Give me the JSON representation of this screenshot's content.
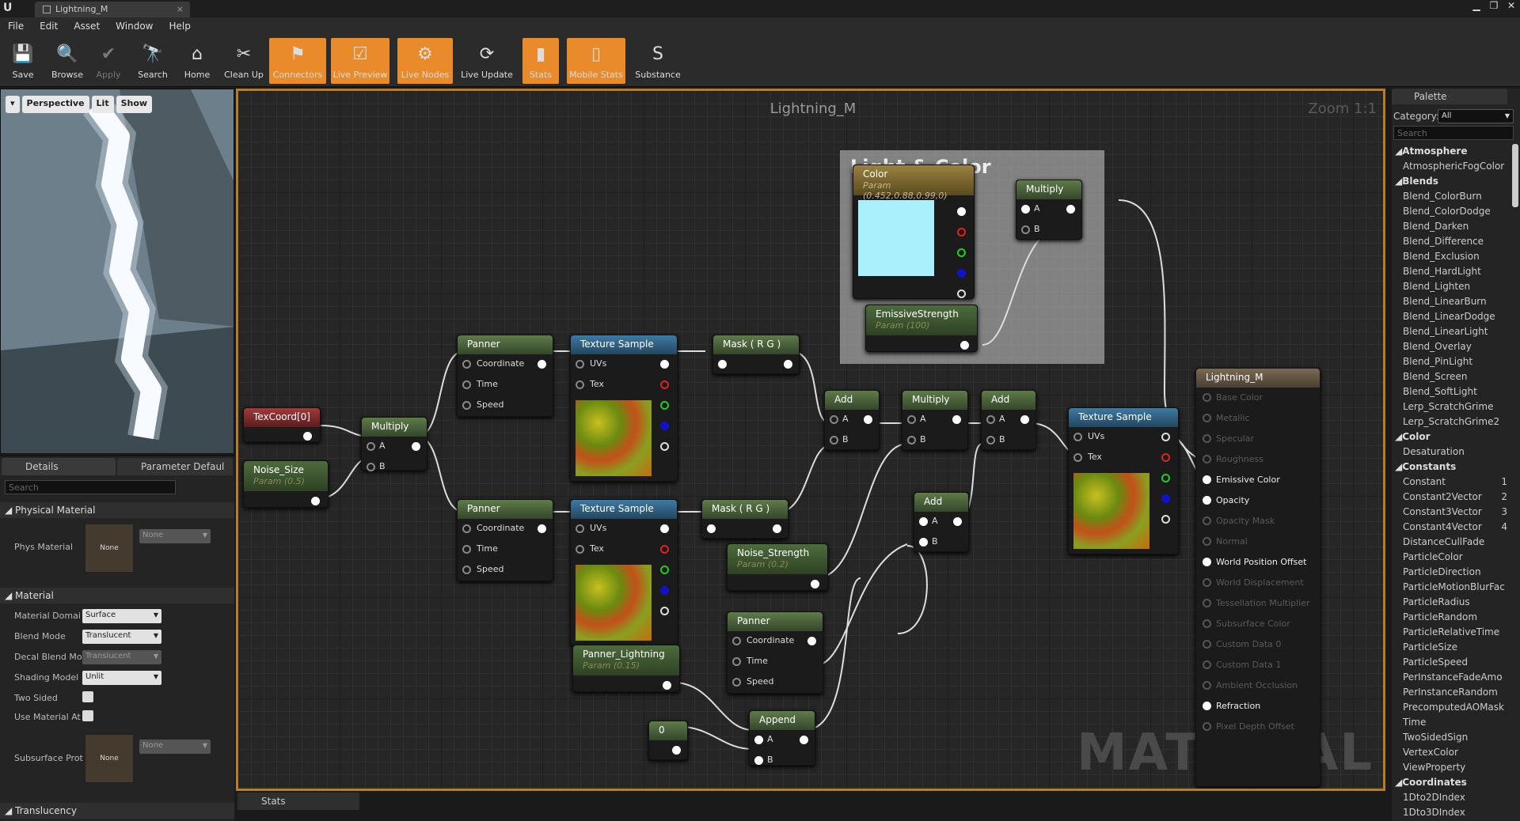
{
  "window": {
    "tab": "Lightning_M",
    "minimize": "▁",
    "restore": "❐",
    "close": "✕"
  },
  "menu": [
    "File",
    "Edit",
    "Asset",
    "Window",
    "Help"
  ],
  "toolbar": [
    {
      "label": "Save",
      "icon": "save-icon",
      "state": "normal"
    },
    {
      "label": "Browse",
      "icon": "browse-icon",
      "state": "normal"
    },
    {
      "label": "Apply",
      "icon": "apply-icon",
      "state": "disabled"
    },
    {
      "label": "Search",
      "icon": "search-icon",
      "state": "normal"
    },
    {
      "label": "Home",
      "icon": "home-icon",
      "state": "normal"
    },
    {
      "label": "Clean Up",
      "icon": "clean-up-icon",
      "state": "normal"
    },
    {
      "label": "Connectors",
      "icon": "connectors-icon",
      "state": "on"
    },
    {
      "label": "Live Preview",
      "icon": "live-preview-icon",
      "state": "on"
    },
    {
      "label": "Live Nodes",
      "icon": "live-nodes-icon",
      "state": "on"
    },
    {
      "label": "Live Update",
      "icon": "live-update-icon",
      "state": "normal"
    },
    {
      "label": "Stats",
      "icon": "stats-icon",
      "state": "on"
    },
    {
      "label": "Mobile Stats",
      "icon": "mobile-stats-icon",
      "state": "on"
    },
    {
      "label": "Substance",
      "icon": "substance-icon",
      "state": "normal"
    }
  ],
  "viewport": {
    "perspective": "Perspective",
    "lit": "Lit",
    "show": "Show"
  },
  "details": {
    "tab1": "Details",
    "tab2": "Parameter Defaul",
    "search_placeholder": "Search",
    "cat_physical": "Physical Material",
    "phys_label": "Phys Material",
    "phys_value": "None",
    "phys_thumb": "None",
    "cat_material": "Material",
    "domain_label": "Material Domai",
    "domain_value": "Surface",
    "blend_label": "Blend Mode",
    "blend_value": "Translucent",
    "decal_label": "Decal Blend Mo",
    "decal_value": "Translucent",
    "shading_label": "Shading Model",
    "shading_value": "Unlit",
    "twosided_label": "Two Sided",
    "usemat_label": "Use Material At",
    "subsurface_label": "Subsurface Prot",
    "subsurface_value": "None",
    "subsurface_thumb": "None",
    "cat_translucency": "Translucency"
  },
  "graph": {
    "title": "Lightning_M",
    "zoom": "Zoom 1:1",
    "watermark": "MATERIAL",
    "comment": "Light & Color"
  },
  "nodes": {
    "texcoord": "TexCoord[0]",
    "noise_size": "Noise_Size",
    "noise_size_param": "Param (0.5)",
    "multiply1": "Multiply",
    "panner1": "Panner",
    "panner2": "Panner",
    "panner3": "Panner",
    "coordinate": "Coordinate",
    "time": "Time",
    "speed": "Speed",
    "texsample": "Texture Sample",
    "uvs": "UVs",
    "tex": "Tex",
    "mask": "Mask ( R G )",
    "panner_lightning": "Panner_Lightning",
    "panner_lightning_param": "Param (0.15)",
    "zero": "0",
    "append": "Append",
    "noise_strength": "Noise_Strength",
    "noise_strength_param": "Param (0.2)",
    "add": "Add",
    "multiply": "Multiply",
    "pin_a": "A",
    "pin_b": "B",
    "color": "Color",
    "color_param": "Param (0.452,0.88,0.99,0)",
    "emissive_strength": "EmissiveStrength",
    "emissive_param": "Param (100)",
    "result": "Lightning_M"
  },
  "result_pins": [
    "Base Color",
    "Metallic",
    "Specular",
    "Roughness",
    "Emissive Color",
    "Opacity",
    "Opacity Mask",
    "Normal",
    "World Position Offset",
    "World Displacement",
    "Tessellation Multiplier",
    "Subsurface Color",
    "Custom Data 0",
    "Custom Data 1",
    "Ambient Occlusion",
    "Refraction",
    "Pixel Depth Offset"
  ],
  "result_active": [
    "Emissive Color",
    "Opacity",
    "World Position Offset",
    "Refraction"
  ],
  "palette": {
    "title": "Palette",
    "category_label": "Category:",
    "category_value": "All",
    "search_placeholder": "Search",
    "items": [
      {
        "t": "Atmosphere",
        "h": true
      },
      {
        "t": "AtmosphericFogColor"
      },
      {
        "t": "Blends",
        "h": true
      },
      {
        "t": "Blend_ColorBurn"
      },
      {
        "t": "Blend_ColorDodge"
      },
      {
        "t": "Blend_Darken"
      },
      {
        "t": "Blend_Difference"
      },
      {
        "t": "Blend_Exclusion"
      },
      {
        "t": "Blend_HardLight"
      },
      {
        "t": "Blend_Lighten"
      },
      {
        "t": "Blend_LinearBurn"
      },
      {
        "t": "Blend_LinearDodge"
      },
      {
        "t": "Blend_LinearLight"
      },
      {
        "t": "Blend_Overlay"
      },
      {
        "t": "Blend_PinLight"
      },
      {
        "t": "Blend_Screen"
      },
      {
        "t": "Blend_SoftLight"
      },
      {
        "t": "Lerp_ScratchGrime"
      },
      {
        "t": "Lerp_ScratchGrime2"
      },
      {
        "t": "Color",
        "h": true
      },
      {
        "t": "Desaturation"
      },
      {
        "t": "Constants",
        "h": true
      },
      {
        "t": "Constant",
        "k": "1"
      },
      {
        "t": "Constant2Vector",
        "k": "2"
      },
      {
        "t": "Constant3Vector",
        "k": "3"
      },
      {
        "t": "Constant4Vector",
        "k": "4"
      },
      {
        "t": "DistanceCullFade"
      },
      {
        "t": "ParticleColor"
      },
      {
        "t": "ParticleDirection"
      },
      {
        "t": "ParticleMotionBlurFac"
      },
      {
        "t": "ParticleRadius"
      },
      {
        "t": "ParticleRandom"
      },
      {
        "t": "ParticleRelativeTime"
      },
      {
        "t": "ParticleSize"
      },
      {
        "t": "ParticleSpeed"
      },
      {
        "t": "PerInstanceFadeAmo"
      },
      {
        "t": "PerInstanceRandom"
      },
      {
        "t": "PrecomputedAOMask"
      },
      {
        "t": "Time"
      },
      {
        "t": "TwoSidedSign"
      },
      {
        "t": "VertexColor"
      },
      {
        "t": "ViewProperty"
      },
      {
        "t": "Coordinates",
        "h": true
      },
      {
        "t": "1Dto2DIndex"
      },
      {
        "t": "1Dto3DIndex"
      }
    ]
  },
  "stats_tab": "Stats",
  "colors": {
    "accent": "#e98b2a",
    "color_swatch": "#aaf0fc"
  }
}
